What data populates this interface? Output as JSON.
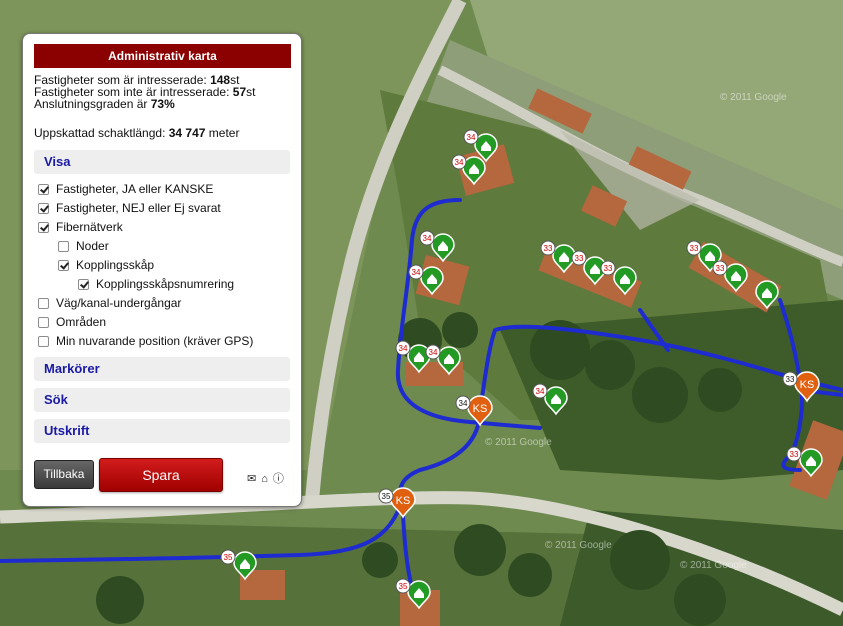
{
  "panel": {
    "title": "Administrativ karta",
    "stats": {
      "interested_label": "Fastigheter som är intresserade: ",
      "interested_value": "148",
      "interested_unit": "st",
      "not_interested_label": "Fastigheter som inte är intresserade: ",
      "not_interested_value": "57",
      "not_interested_unit": "st",
      "connection_label": "Anslutningsgraden är ",
      "connection_value": "73%"
    },
    "length_label": "Uppskattad schaktlängd: ",
    "length_value": "34 747",
    "length_unit": " meter",
    "sections": {
      "visa": "Visa",
      "markorer": "Markörer",
      "sok": "Sök",
      "utskrift": "Utskrift"
    },
    "options": [
      {
        "label": "Fastigheter, JA eller KANSKE",
        "checked": true
      },
      {
        "label": "Fastigheter, NEJ eller Ej svarat",
        "checked": true
      },
      {
        "label": "Fibernätverk",
        "checked": true
      },
      {
        "label": "Noder",
        "checked": false
      },
      {
        "label": "Kopplingsskåp",
        "checked": true
      },
      {
        "label": "Kopplingsskåpsnumrering",
        "checked": true
      },
      {
        "label": "Väg/kanal-undergångar",
        "checked": false
      },
      {
        "label": "Områden",
        "checked": false
      },
      {
        "label": "Min nuvarande position (kräver GPS)",
        "checked": false
      }
    ],
    "back_label": "Tillbaka",
    "save_label": "Spara",
    "icons": [
      "mail-icon",
      "home-icon",
      "info-icon"
    ]
  },
  "map": {
    "watermarks": [
      "© 2011 Google",
      "© 2011 Google",
      "© 2011 Google",
      "© 2011 Google"
    ],
    "cabinet_label": "KS",
    "cabinets": [
      {
        "number": "34"
      },
      {
        "number": "33"
      },
      {
        "number": "35"
      }
    ],
    "house_markers": [
      {
        "number": "34"
      },
      {
        "number": "34"
      },
      {
        "number": "34"
      },
      {
        "number": "34"
      },
      {
        "number": "34"
      },
      {
        "number": "34"
      },
      {
        "number": "34"
      },
      {
        "number": "33"
      },
      {
        "number": "33"
      },
      {
        "number": "33"
      },
      {
        "number": "33"
      },
      {
        "number": "33"
      },
      {
        "number": "33"
      },
      {
        "number": "35"
      },
      {
        "number": "35"
      }
    ],
    "colors": {
      "fiber": "#1e2bd0",
      "cabinet": "#e06010",
      "house": "#239a23",
      "panel_header": "#8b0000"
    }
  }
}
